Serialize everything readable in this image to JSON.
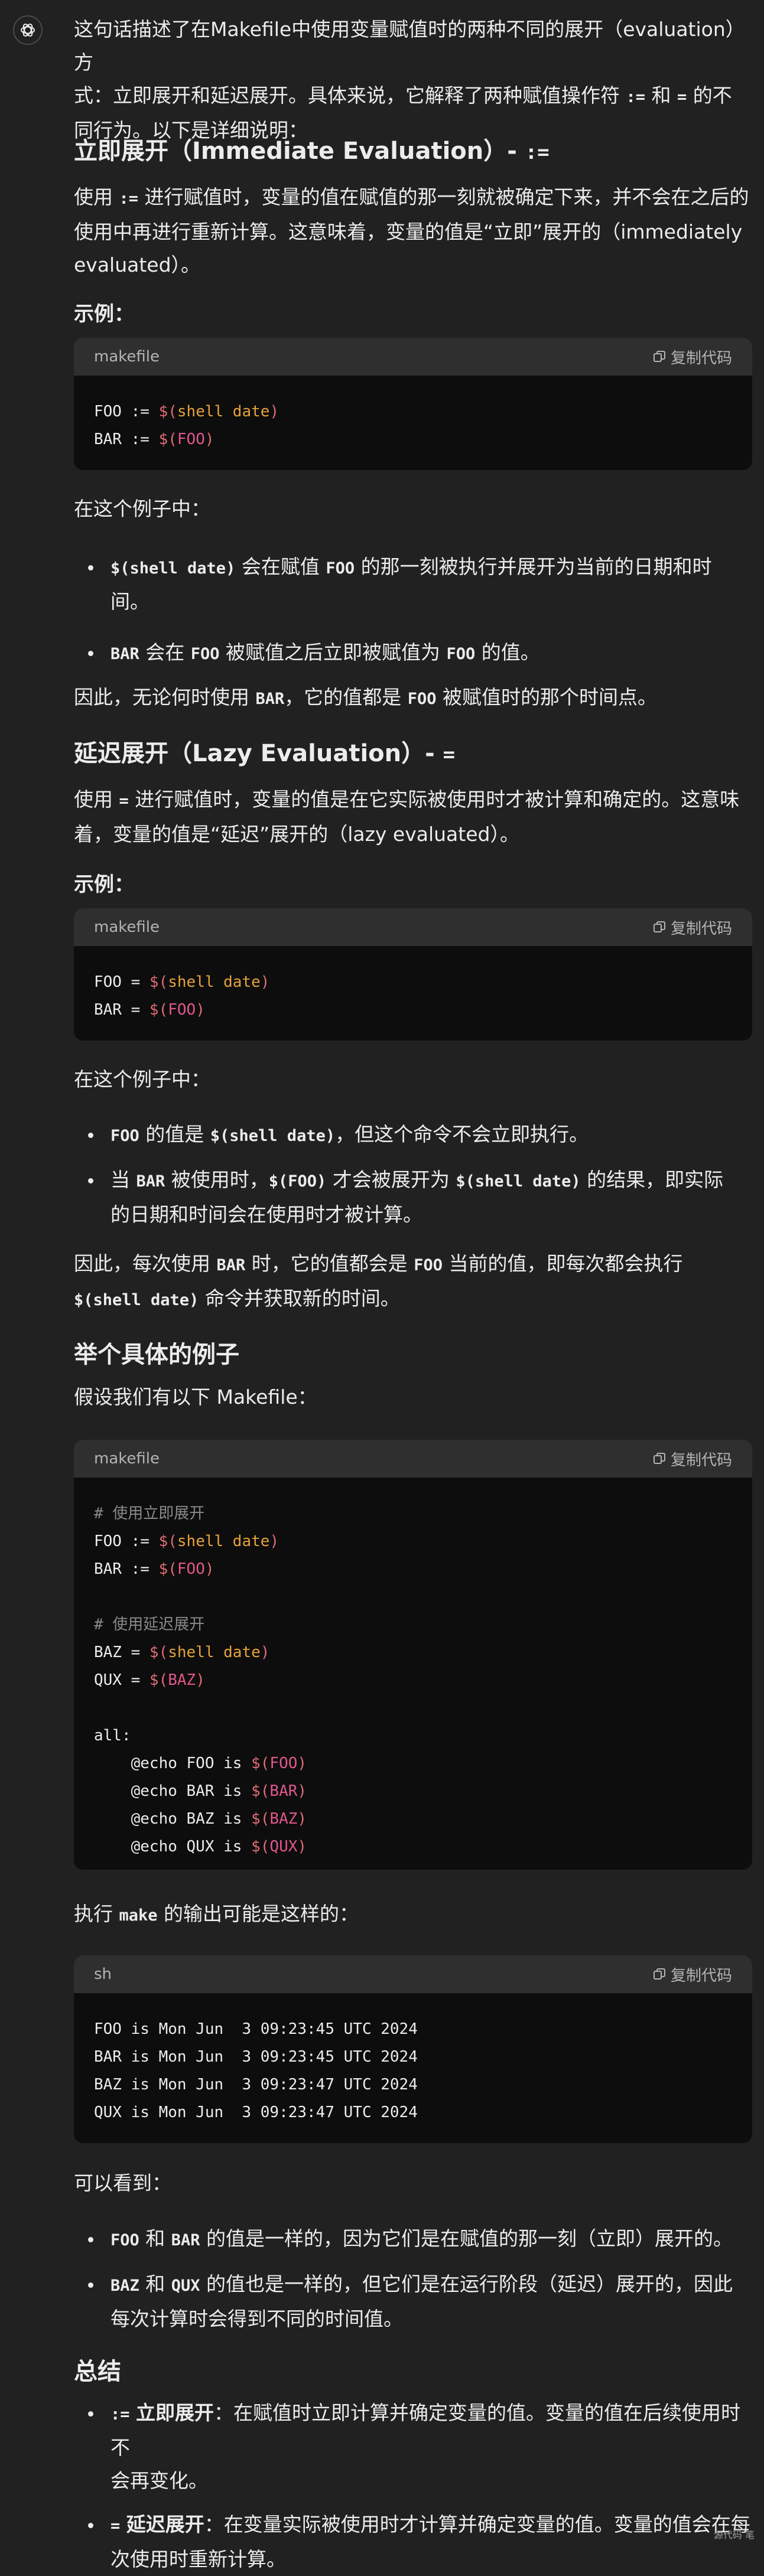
{
  "intro": [
    "这句话描述了在Makefile中使用变量赋值时的两种不同的展开（evaluation）方",
    "式：立即展开和延迟展开。具体来说，它解释了两种赋值操作符 ",
    ":=",
    " 和 ",
    "=",
    " 的不",
    "同行为。以下是详细说明："
  ],
  "s1": {
    "heading": "立即展开（Immediate Evaluation）- ",
    "heading_code": ":=",
    "p1": [
      "使用 ",
      ":=",
      " 进行赋值时，变量的值在赋值的那一刻就被确定下来，并不会在之后的",
      "使用中再进行重新计算。这意味着，变量的值是“立即”展开的（immediately",
      "evaluated）。"
    ],
    "example_label": "示例：",
    "code_lang": "makefile",
    "copy_label": "复制代码",
    "code": [
      [
        "FOO := ",
        "$(",
        "shell date",
        ")"
      ],
      [
        "BAR := ",
        "$(",
        "FOO",
        ")"
      ]
    ],
    "in_example": "在这个例子中：",
    "bullets": [
      [
        "",
        "$(shell date)",
        " 会在赋值 ",
        "FOO",
        " 的那一刻被执行并展开为当前的日期和时",
        "间。"
      ],
      [
        "",
        "BAR",
        " 会在 ",
        "FOO",
        " 被赋值之后立即被赋值为 ",
        "FOO",
        " 的值。"
      ]
    ],
    "conclusion": [
      "因此，无论何时使用 ",
      "BAR",
      "，它的值都是 ",
      "FOO",
      " 被赋值时的那个时间点。"
    ]
  },
  "s2": {
    "heading": "延迟展开（Lazy Evaluation）- ",
    "heading_code": "=",
    "p1": [
      "使用 ",
      "=",
      " 进行赋值时，变量的值是在它实际被使用时才被计算和确定的。这意味",
      "着，变量的值是“延迟”展开的（lazy evaluated）。"
    ],
    "example_label": "示例：",
    "code_lang": "makefile",
    "copy_label": "复制代码",
    "code": [
      [
        "FOO = ",
        "$(",
        "shell date",
        ")"
      ],
      [
        "BAR = ",
        "$(",
        "FOO",
        ")"
      ]
    ],
    "in_example": "在这个例子中：",
    "bullets": [
      [
        "",
        "FOO",
        " 的值是 ",
        "$(shell date)",
        "，但这个命令不会立即执行。"
      ],
      [
        "当 ",
        "BAR",
        " 被使用时，",
        "$(FOO)",
        " 才会被展开为 ",
        "$(shell date)",
        " 的结果，即实际",
        "的日期和时间会在使用时才被计算。"
      ]
    ],
    "conclusion": [
      "因此，每次使用 ",
      "BAR",
      " 时，它的值都会是 ",
      "FOO",
      " 当前的值，即每次都会执行",
      "$(shell date)",
      " 命令并获取新的时间。"
    ]
  },
  "s3": {
    "heading": "举个具体的例子",
    "intro": "假设我们有以下 Makefile：",
    "code_lang": "makefile",
    "copy_label": "复制代码",
    "code": {
      "c1": "# 使用立即展开",
      "l1": [
        "FOO := ",
        "$(",
        "shell date",
        ")"
      ],
      "l2": [
        "BAR := ",
        "$(",
        "FOO",
        ")"
      ],
      "c2": "# 使用延迟展开",
      "l3": [
        "BAZ = ",
        "$(",
        "shell date",
        ")"
      ],
      "l4": [
        "QUX = ",
        "$(",
        "BAZ",
        ")"
      ],
      "target": "all:",
      "e1": [
        "    @echo FOO is ",
        "$(",
        "FOO",
        ")"
      ],
      "e2": [
        "    @echo BAR is ",
        "$(",
        "BAR",
        ")"
      ],
      "e3": [
        "    @echo BAZ is ",
        "$(",
        "BAZ",
        ")"
      ],
      "e4": [
        "    @echo QUX is ",
        "$(",
        "QUX",
        ")"
      ]
    },
    "run_text": [
      "执行 ",
      "make",
      " 的输出可能是这样的："
    ],
    "sh_lang": "sh",
    "sh_lines": [
      "FOO is Mon Jun  3 09:23:45 UTC 2024",
      "BAR is Mon Jun  3 09:23:45 UTC 2024",
      "BAZ is Mon Jun  3 09:23:47 UTC 2024",
      "QUX is Mon Jun  3 09:23:47 UTC 2024"
    ],
    "see": "可以看到：",
    "bullets": [
      [
        "",
        "FOO",
        " 和 ",
        "BAR",
        " 的值是一样的，因为它们是在赋值的那一刻（立即）展开的。"
      ],
      [
        "",
        "BAZ",
        " 和 ",
        "QUX",
        " 的值也是一样的，但它们是在运行阶段（延迟）展开的，因此",
        "每次计算时会得到不同的时间值。"
      ]
    ]
  },
  "summary": {
    "heading": "总结",
    "bullets": [
      [
        "",
        ":=",
        " ",
        "立即展开",
        "：在赋值时立即计算并确定变量的值。变量的值在后续使用时不",
        "会再变化。"
      ],
      [
        "",
        "=",
        " ",
        "延迟展开",
        "：在变量实际被使用时才计算并确定变量的值。变量的值会在每",
        "次使用时重新计算。"
      ]
    ]
  },
  "footer": "源代码   笔"
}
